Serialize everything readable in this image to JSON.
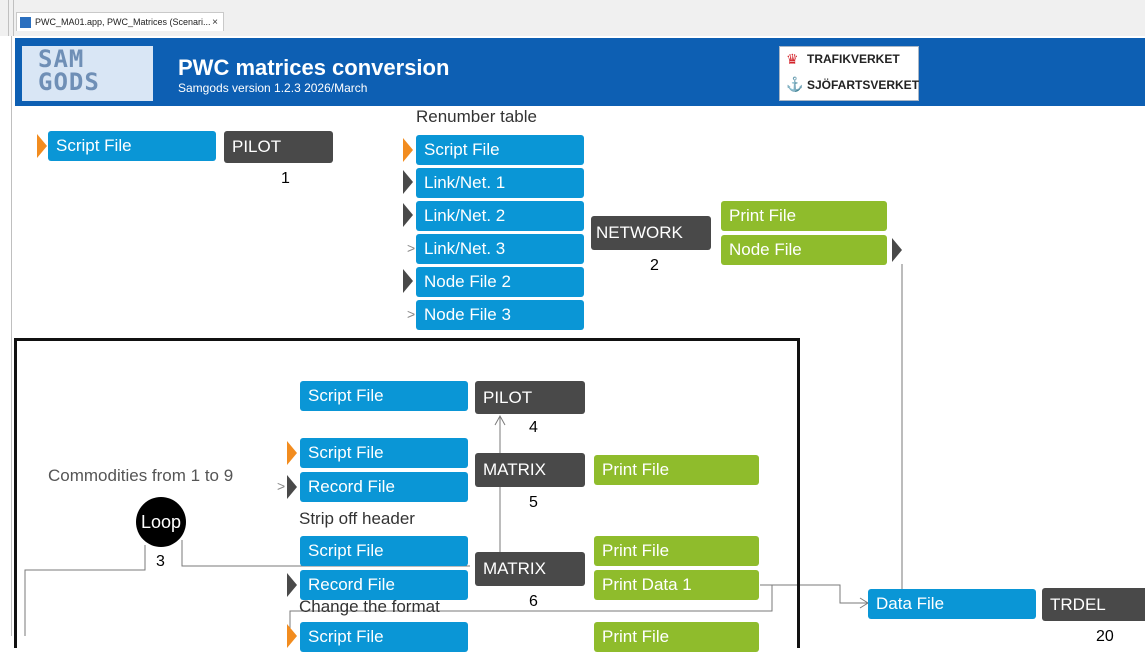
{
  "tab": {
    "label": "PWC_MA01.app, PWC_Matrices (Scenari...",
    "close": "×"
  },
  "header": {
    "logo_text": "SAM\nGODS",
    "title": "PWC matrices conversion",
    "subtitle": "Samgods version 1.2.3 2026/March",
    "partner1": "TRAFIKVERKET",
    "partner2": "SJÖFARTSVERKET"
  },
  "diagram": {
    "step1": {
      "input": "Script File",
      "program": "PILOT",
      "number": "1"
    },
    "step2": {
      "caption": "Renumber table",
      "inputs": [
        "Script File",
        "Link/Net. 1",
        "Link/Net. 2",
        "Link/Net. 3",
        "Node File 2",
        "Node File 3"
      ],
      "program": "NETWORK",
      "number": "2",
      "outputs": [
        "Print File",
        "Node File"
      ]
    },
    "loop": {
      "label": "Loop",
      "number": "3",
      "caption": "Commodities from 1 to 9"
    },
    "step4": {
      "input": "Script File",
      "program": "PILOT",
      "number": "4"
    },
    "step5": {
      "inputs": [
        "Script File",
        "Record File"
      ],
      "program": "MATRIX",
      "number": "5",
      "output": "Print File"
    },
    "step6": {
      "caption": "Strip off header",
      "inputs": [
        "Script File",
        "Record File"
      ],
      "program": "MATRIX",
      "number": "6",
      "outputs": [
        "Print File",
        "Print Data 1"
      ]
    },
    "step7": {
      "caption": "Change the format",
      "input": "Script File",
      "output": "Print File"
    },
    "step20": {
      "input": "Data File",
      "program": "TRDEL",
      "number": "20"
    }
  }
}
